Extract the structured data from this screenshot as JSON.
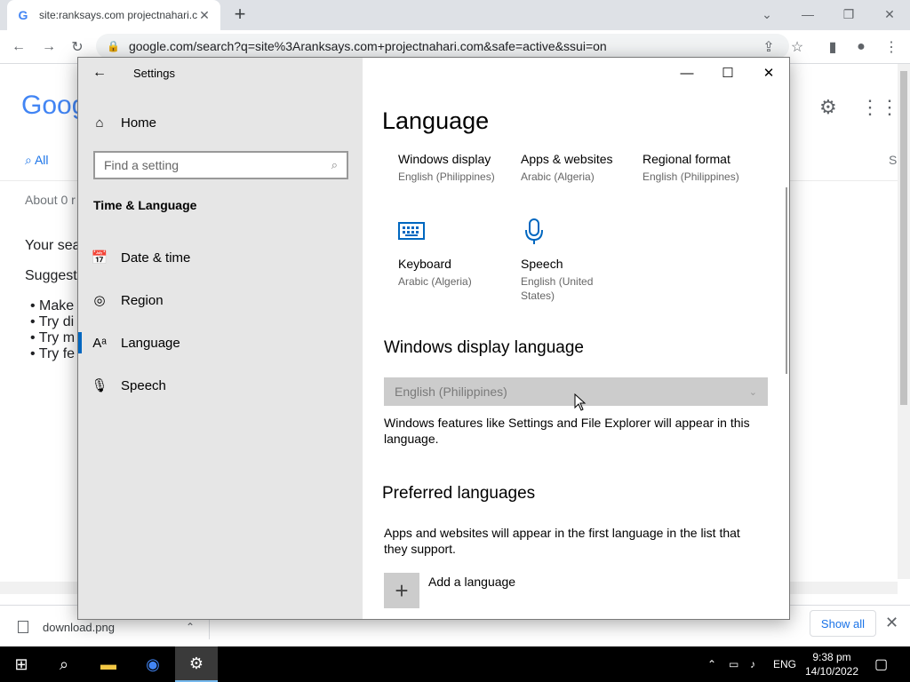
{
  "browser": {
    "tab_title": "site:ranksays.com projectnahari.c",
    "tab_favicon": "G",
    "url": "google.com/search?q=site%3Aranksays.com+projectnahari.com&safe=active&ssui=on"
  },
  "google": {
    "logo": "Goog",
    "tab_all": "All",
    "about": "About 0 r",
    "your_search": "Your sea",
    "suggest": "Suggest",
    "bullets": [
      "Make",
      "Try di",
      "Try m",
      "Try fe"
    ],
    "right_tab": "S"
  },
  "downloads": {
    "file_name": "download.png",
    "show_all": "Show all"
  },
  "taskbar": {
    "lang": "ENG",
    "time": "9:38 pm",
    "date": "14/10/2022"
  },
  "settings": {
    "window_title": "Settings",
    "home": "Home",
    "search_placeholder": "Find a setting",
    "section": "Time & Language",
    "nav": [
      {
        "label": "Date & time"
      },
      {
        "label": "Region"
      },
      {
        "label": "Language"
      },
      {
        "label": "Speech"
      }
    ],
    "page_title": "Language",
    "tiles": [
      {
        "title": "Windows display",
        "sub": "English (Philippines)"
      },
      {
        "title": "Apps & websites",
        "sub": "Arabic (Algeria)"
      },
      {
        "title": "Regional format",
        "sub": "English (Philippines)"
      },
      {
        "title": "Keyboard",
        "sub": "Arabic (Algeria)"
      },
      {
        "title": "Speech",
        "sub": "English (United States)"
      }
    ],
    "display_lang_heading": "Windows display language",
    "display_lang_value": "English (Philippines)",
    "display_lang_desc": "Windows features like Settings and File Explorer will appear in this language.",
    "preferred_heading": "Preferred languages",
    "preferred_desc": "Apps and websites will appear in the first language in the list that they support.",
    "add_language": "Add a language"
  }
}
